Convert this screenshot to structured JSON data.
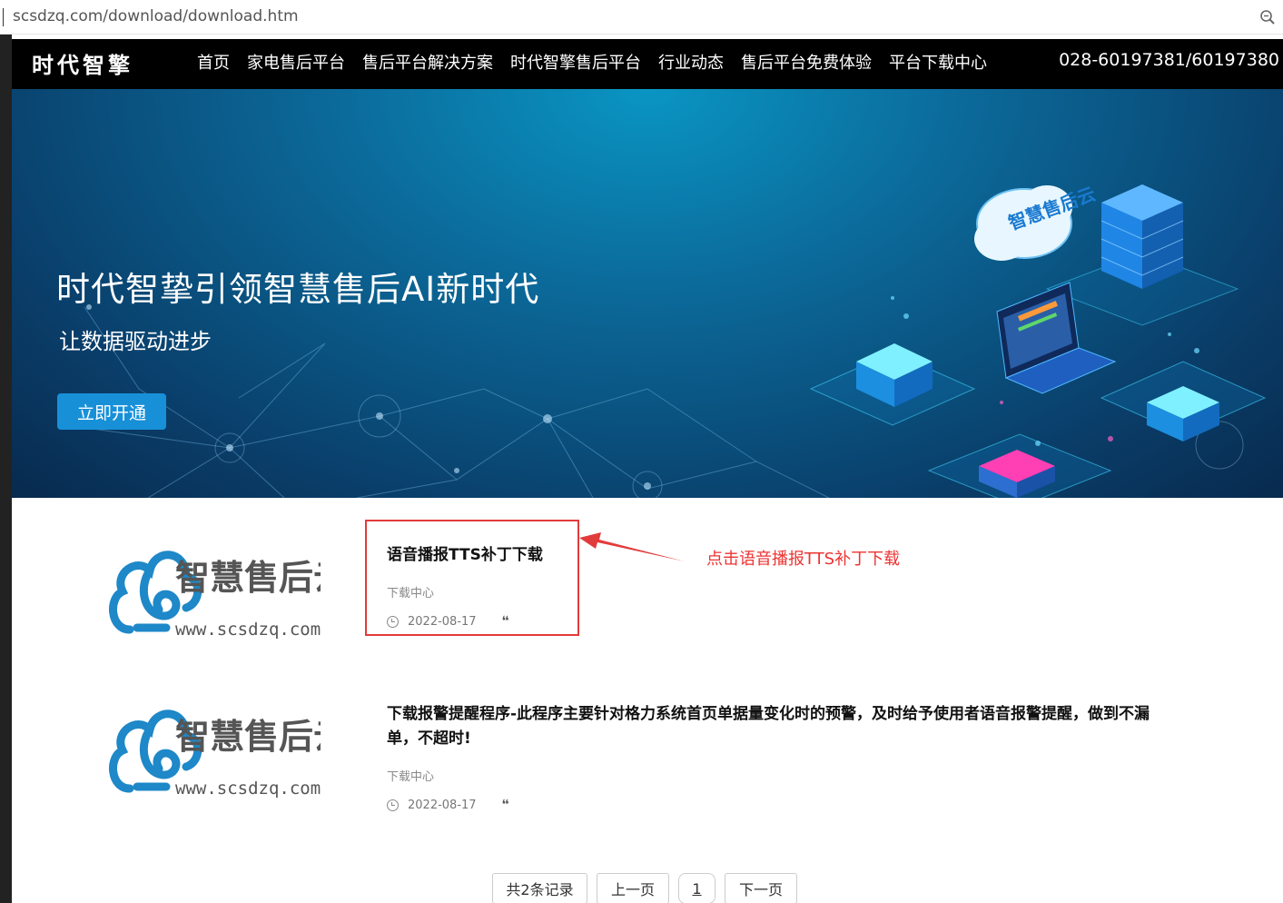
{
  "address_bar": {
    "url": "scsdzq.com/download/download.htm"
  },
  "nav": {
    "brand": "时代智擎",
    "items": [
      "首页",
      "家电售后平台",
      "售后平台解决方案",
      "时代智擎售后平台",
      "行业动态",
      "售后平台免费体验",
      "平台下载中心"
    ],
    "phone": "028-60197381/60197380"
  },
  "banner": {
    "title": "时代智挚引领智慧售后AI新时代",
    "subtitle": "让数据驱动进步",
    "button": "立即开通",
    "cloud_text": "智慧售后云"
  },
  "logo": {
    "cn": "智慧售后云",
    "url": "www.scsdzq.com"
  },
  "items": [
    {
      "title": "语音播报TTS补丁下载",
      "category": "下载中心",
      "date": "2022-08-17"
    },
    {
      "title": "下载报警提醒程序-此程序主要针对格力系统首页单据量变化时的预警，及时给予使用者语音报警提醒，做到不漏单，不超时!",
      "category": "下载中心",
      "date": "2022-08-17"
    }
  ],
  "annotation": "点击语音播报TTS补丁下载",
  "pagination": {
    "total": "共2条记录",
    "prev": "上一页",
    "page": "1",
    "next": "下一页"
  },
  "colors": {
    "nav_bg": "#000000",
    "accent": "#1890d8",
    "annotation": "#e23b3b",
    "logo_blue": "#1e88c8"
  }
}
